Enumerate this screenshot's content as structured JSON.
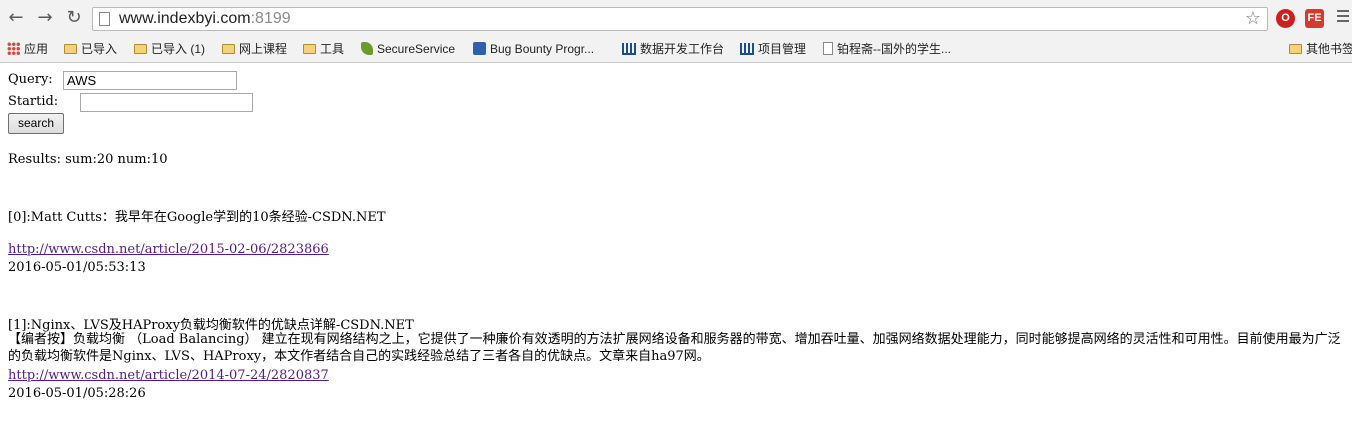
{
  "browser": {
    "url_host": "www.indexbyi.com",
    "url_port": ":8199",
    "nav": {
      "back_icon": "back-arrow-icon",
      "forward_icon": "forward-arrow-icon",
      "reload_icon": "reload-icon"
    },
    "extensions": [
      {
        "label": "O",
        "color": "#cc1f1f"
      },
      {
        "label": "FE",
        "color": "#d43a2f"
      }
    ]
  },
  "bookmarks": {
    "items": [
      {
        "label": "应用",
        "icon": "apps-grid-icon"
      },
      {
        "label": "已导入",
        "icon": "folder-icon"
      },
      {
        "label": "已导入 (1)",
        "icon": "folder-icon"
      },
      {
        "label": "网上课程",
        "icon": "folder-icon"
      },
      {
        "label": "工具",
        "icon": "folder-icon"
      },
      {
        "label": "SecureService",
        "icon": "leaf-icon"
      },
      {
        "label": "Bug Bounty Progr...",
        "icon": "bug-icon"
      },
      {
        "label": "数据开发工作台",
        "icon": "bars-icon"
      },
      {
        "label": "项目管理",
        "icon": "bars-icon"
      },
      {
        "label": "铂程斋--国外的学生...",
        "icon": "doc-icon"
      }
    ],
    "other": {
      "label": "其他书签",
      "icon": "folder-icon"
    }
  },
  "form": {
    "query_label": "Query:",
    "query_value": "AWS",
    "startid_label": "Startid:",
    "startid_value": "",
    "search_label": "search"
  },
  "results_summary": "Results: sum:20 num:10",
  "results": [
    {
      "title": "[0]:Matt Cutts：我早年在Google学到的10条经验-CSDN.NET",
      "description": "",
      "url": "http://www.csdn.net/article/2015-02-06/2823866",
      "time": "2016-05-01/05:53:13"
    },
    {
      "title": "[1]:Nginx、LVS及HAProxy负载均衡软件的优缺点详解-CSDN.NET",
      "description": "【编者按】负载均衡 （Load Balancing） 建立在现有网络结构之上，它提供了一种廉价有效透明的方法扩展网络设备和服务器的带宽、增加吞吐量、加强网络数据处理能力，同时能够提高网络的灵活性和可用性。目前使用最为广泛的负载均衡软件是Nginx、LVS、HAProxy，本文作者结合自己的实践经验总结了三者各自的优缺点。文章来自ha97网。",
      "url": "http://www.csdn.net/article/2014-07-24/2820837",
      "time": "2016-05-01/05:28:26"
    }
  ]
}
